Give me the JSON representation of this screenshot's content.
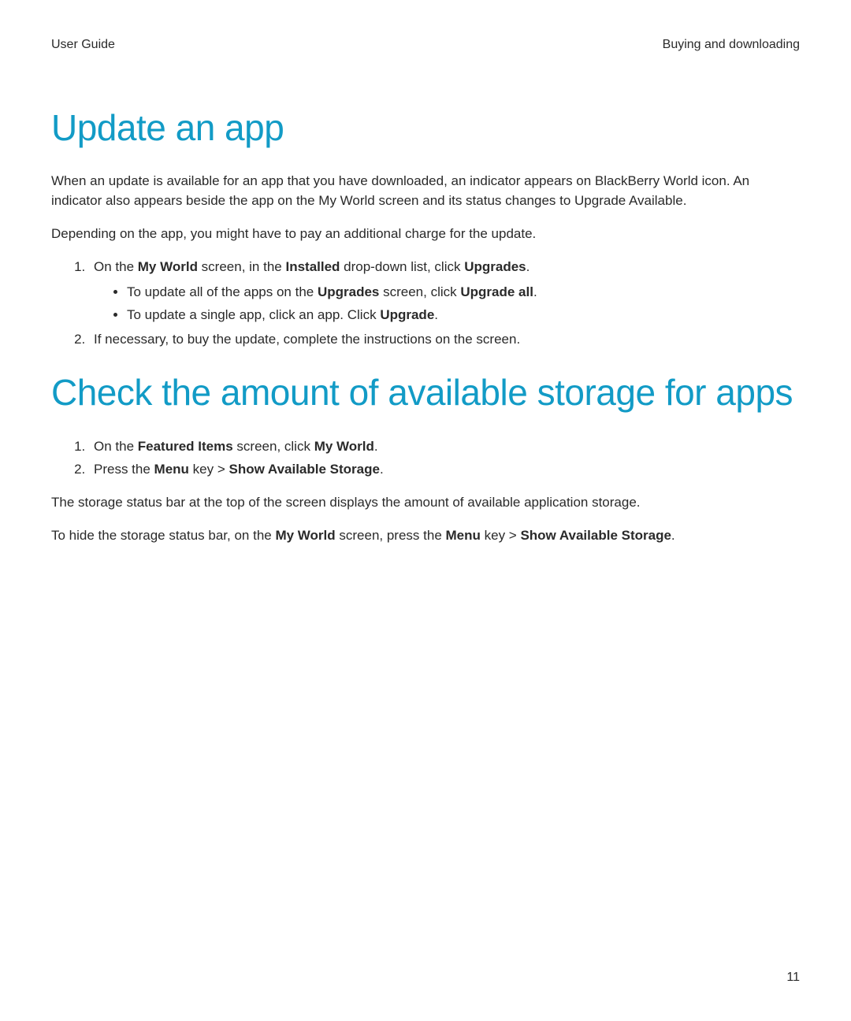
{
  "header": {
    "left": "User Guide",
    "right": "Buying and downloading"
  },
  "section1": {
    "title": "Update an app",
    "para1": "When an update is available for an app that you have downloaded, an indicator appears on BlackBerry World icon. An indicator also appears beside the app on the My World screen and its status changes to Upgrade Available.",
    "para2": "Depending on the app, you might have to pay an additional charge for the update.",
    "step1_a": "On the ",
    "step1_b": "My World",
    "step1_c": " screen, in the ",
    "step1_d": "Installed",
    "step1_e": " drop-down list, click ",
    "step1_f": "Upgrades",
    "step1_g": ".",
    "bullet1_a": "To update all of the apps on the ",
    "bullet1_b": "Upgrades",
    "bullet1_c": " screen, click ",
    "bullet1_d": "Upgrade all",
    "bullet1_e": ".",
    "bullet2_a": "To update a single app, click an app. Click ",
    "bullet2_b": "Upgrade",
    "bullet2_c": ".",
    "step2": "If necessary, to buy the update, complete the instructions on the screen."
  },
  "section2": {
    "title": "Check the amount of available storage for apps",
    "step1_a": "On the ",
    "step1_b": "Featured Items",
    "step1_c": " screen, click ",
    "step1_d": "My World",
    "step1_e": ".",
    "step2_a": "Press the ",
    "step2_b": "Menu",
    "step2_c": " key > ",
    "step2_d": "Show Available Storage",
    "step2_e": ".",
    "para1": "The storage status bar at the top of the screen displays the amount of available application storage.",
    "para2_a": "To hide the storage status bar, on the ",
    "para2_b": "My World",
    "para2_c": " screen, press the ",
    "para2_d": "Menu",
    "para2_e": " key > ",
    "para2_f": "Show Available Storage",
    "para2_g": "."
  },
  "pageNumber": "11"
}
